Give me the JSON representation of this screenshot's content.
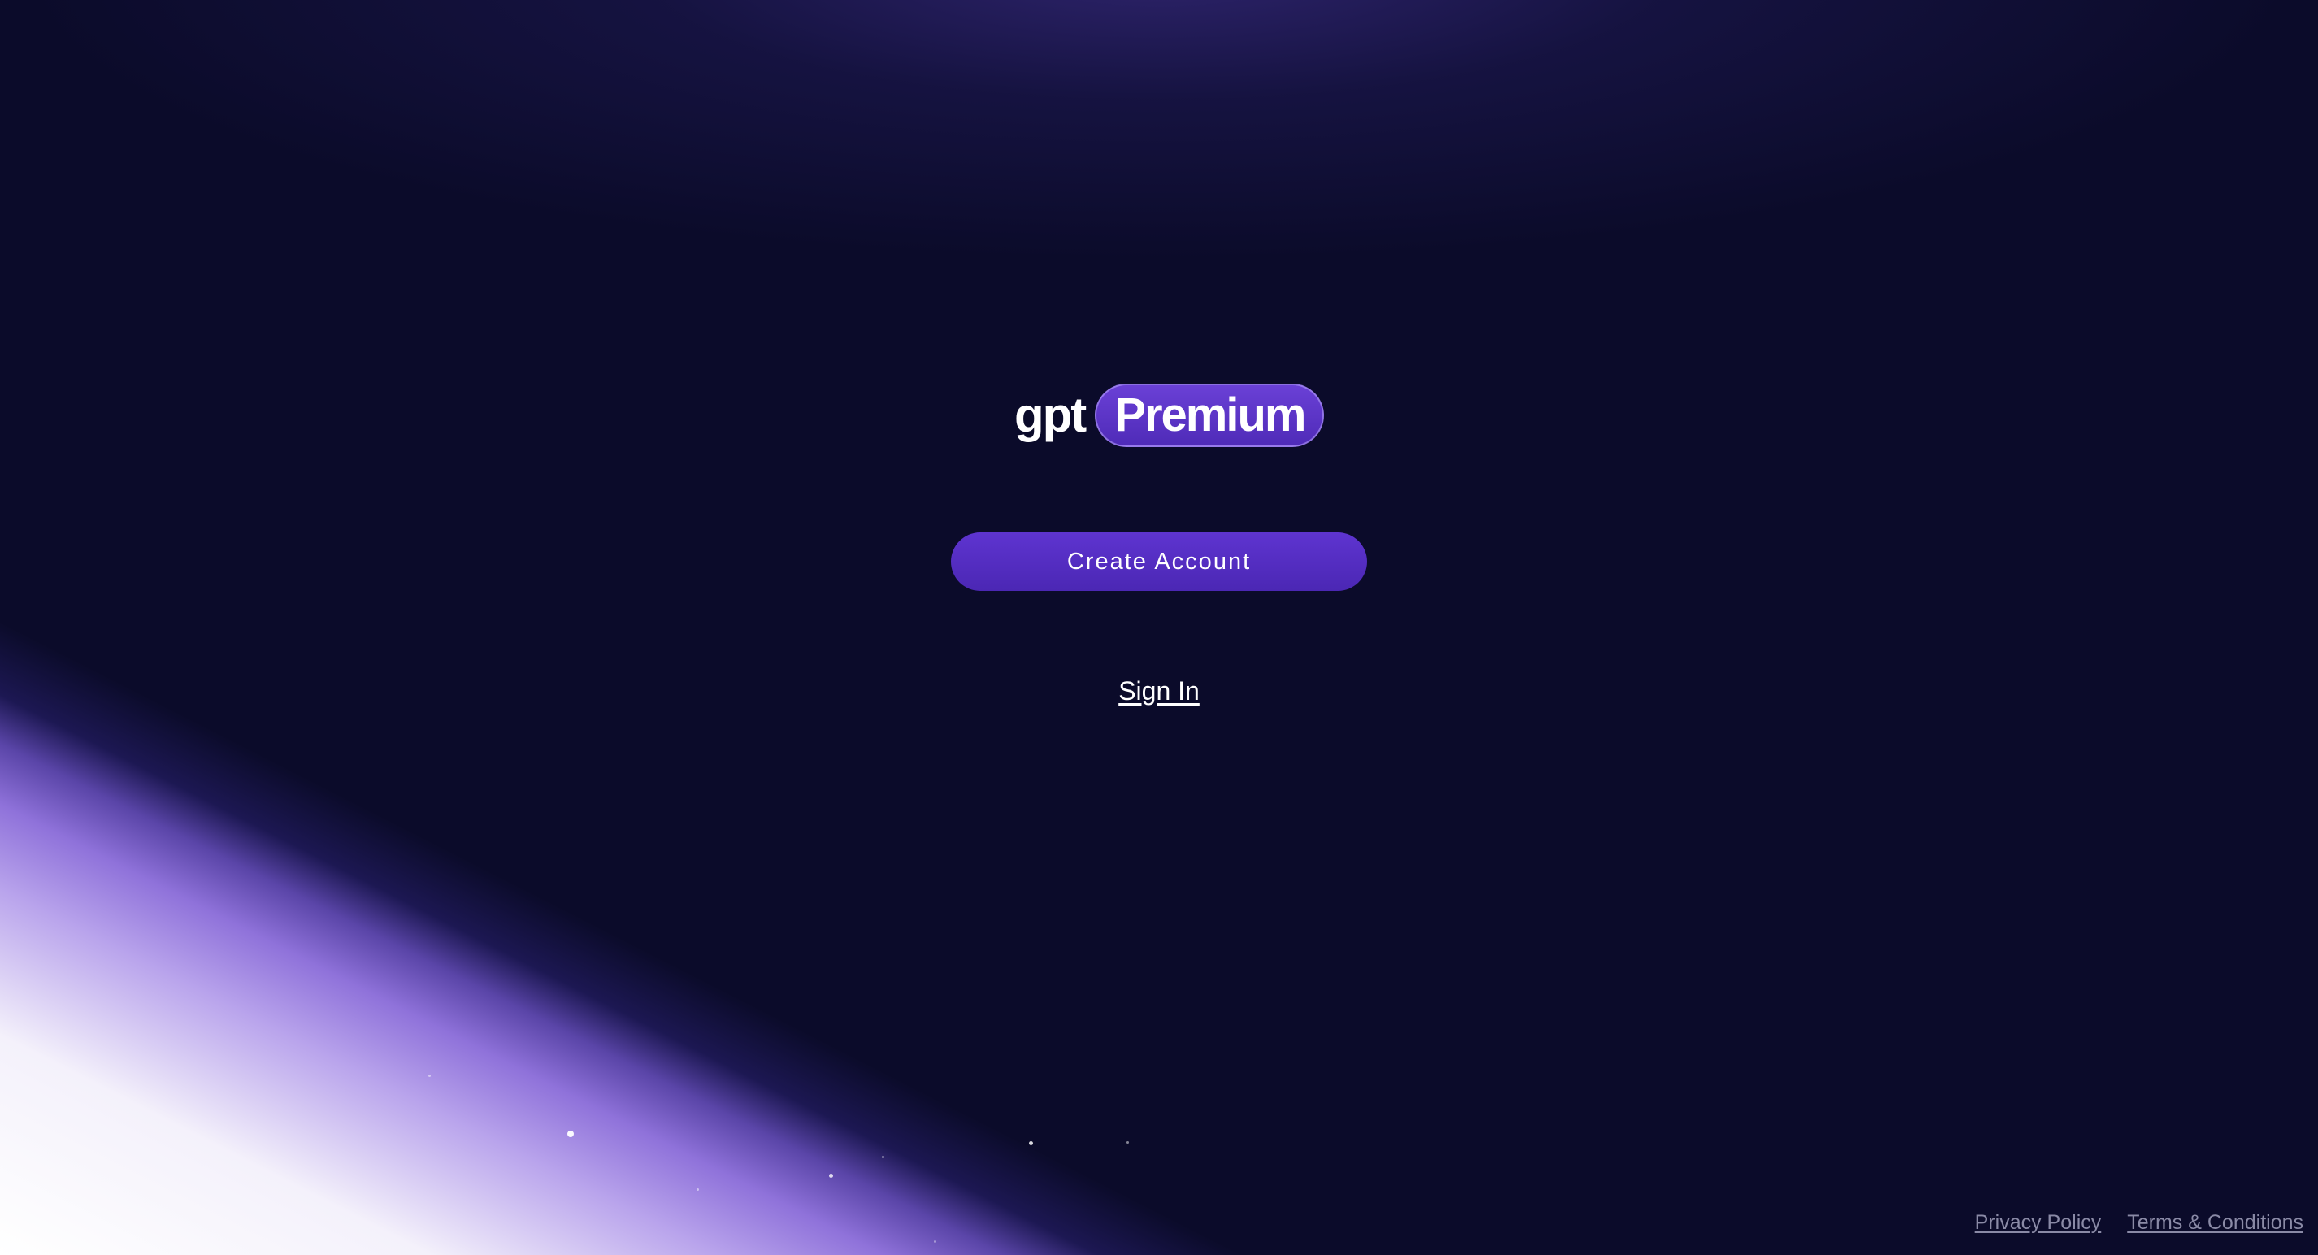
{
  "logo": {
    "prefix": "gpt",
    "badge": "Premium"
  },
  "actions": {
    "create_account_label": "Create Account",
    "sign_in_label": "Sign In"
  },
  "footer": {
    "privacy_label": "Privacy Policy",
    "terms_label": "Terms & Conditions"
  },
  "colors": {
    "background": "#0b0b2a",
    "accent": "#5e34d0",
    "footer_link": "#8a8aa6"
  }
}
